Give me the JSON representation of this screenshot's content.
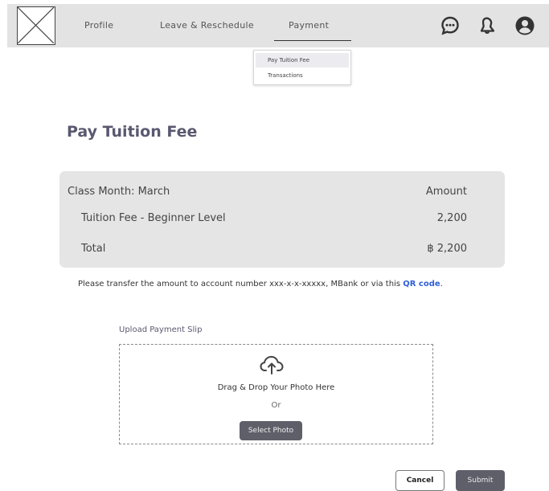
{
  "nav": {
    "items": [
      {
        "label": "Profile"
      },
      {
        "label": "Leave & Reschedule"
      },
      {
        "label": "Payment"
      }
    ],
    "active": "Payment",
    "icons": [
      "chat-icon",
      "bell-icon",
      "user-account-icon"
    ]
  },
  "dropdown": {
    "items": [
      {
        "label": "Pay Tuition Fee"
      },
      {
        "label": "Transactions"
      }
    ],
    "active": "Pay Tuition Fee"
  },
  "page": {
    "title": "Pay Tuition Fee"
  },
  "fee_card": {
    "class_month": "Class Month: March",
    "amount_header": "Amount",
    "line_item_label": "Tuition Fee - Beginner Level",
    "line_item_amount": "2,200",
    "total_label": "Total",
    "total_amount": "฿ 2,200"
  },
  "payment_note": {
    "text": "Please transfer the amount to account number xxx-x-x-xxxxx, MBank or via this ",
    "link": "QR code",
    "suffix": "."
  },
  "upload": {
    "label": "Upload Payment Slip",
    "drag_text": "Drag & Drop Your Photo Here",
    "or_text": "Or",
    "select_label": "Select Photo"
  },
  "actions": {
    "cancel_label": "Cancel",
    "submit_label": "Submit"
  },
  "colors": {
    "accent": "#5f5f6a",
    "title": "#5a5870",
    "link": "#2f5fd6",
    "topbar": "#e3e3e3",
    "card": "#e5e5e5"
  }
}
